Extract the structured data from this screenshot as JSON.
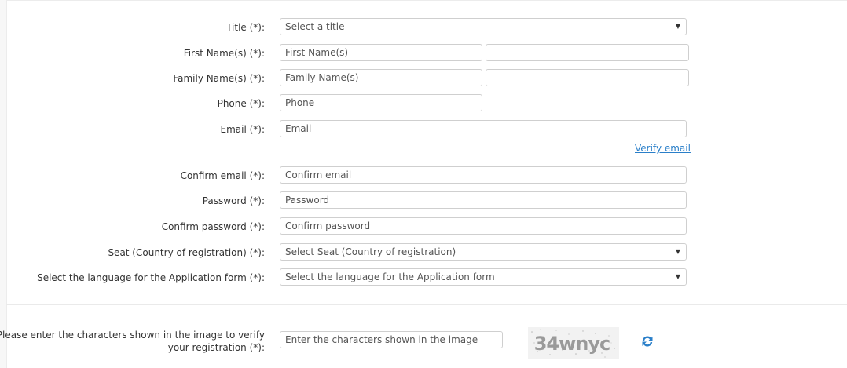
{
  "form": {
    "title": {
      "label": "Title (*):",
      "value": "Select a title"
    },
    "first_name": {
      "label": "First Name(s) (*):",
      "placeholder": "First Name(s)",
      "second_placeholder": ""
    },
    "family_name": {
      "label": "Family Name(s) (*):",
      "placeholder": "Family Name(s)",
      "second_placeholder": ""
    },
    "phone": {
      "label": "Phone (*):",
      "placeholder": "Phone"
    },
    "email": {
      "label": "Email (*):",
      "placeholder": "Email"
    },
    "verify_email_link": "Verify email",
    "confirm_email": {
      "label": "Confirm email (*):",
      "placeholder": "Confirm email"
    },
    "password": {
      "label": "Password (*):",
      "placeholder": "Password"
    },
    "confirm_password": {
      "label": "Confirm password (*):",
      "placeholder": "Confirm password"
    },
    "seat": {
      "label": "Seat (Country of registration) (*):",
      "value": "Select Seat (Country of registration)"
    },
    "language": {
      "label": "Select the language for the Application form (*):",
      "value": "Select the language for the Application form"
    },
    "captcha": {
      "label_line1": "Please enter the characters shown in the image to verify",
      "label_line2": "your registration (*):",
      "placeholder": "Enter the characters shown in the image",
      "image_text": "34wnyc"
    }
  },
  "icons": {
    "select_caret": "▼",
    "refresh": "refresh-icon"
  },
  "colors": {
    "link": "#2a7fc9",
    "border": "#cfcfcf",
    "refresh": "#2a7fc9"
  }
}
